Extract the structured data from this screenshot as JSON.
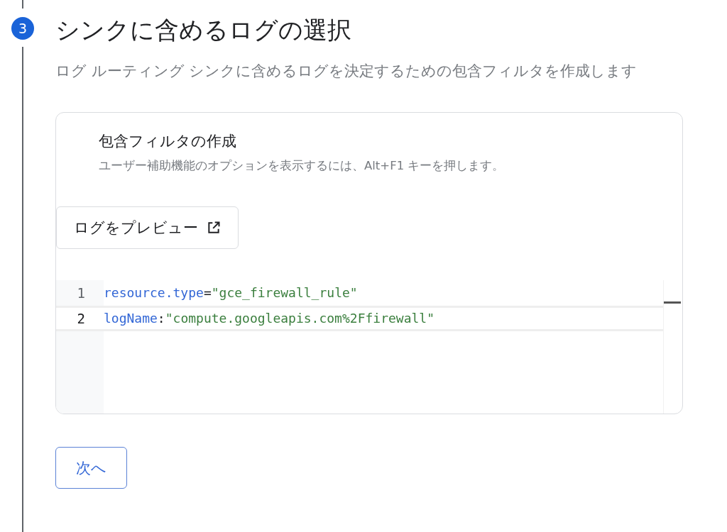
{
  "step": {
    "number": "3",
    "title": "シンクに含めるログの選択",
    "description": "ログ ルーティング シンクに含めるログを決定するための包含フィルタを作成します"
  },
  "filter_card": {
    "title": "包含フィルタの作成",
    "hint": "ユーザー補助機能のオプションを表示するには、Alt+F1 キーを押します。",
    "preview_button": "ログをプレビュー"
  },
  "editor": {
    "lines": [
      {
        "number": "1",
        "selected": false,
        "tokens": [
          {
            "kind": "key",
            "text": "resource.type"
          },
          {
            "kind": "op",
            "text": "="
          },
          {
            "kind": "string",
            "text": "\"gce_firewall_rule\""
          }
        ]
      },
      {
        "number": "2",
        "selected": true,
        "tokens": [
          {
            "kind": "key",
            "text": "logName"
          },
          {
            "kind": "op",
            "text": ":"
          },
          {
            "kind": "string",
            "text": "\"compute.googleapis.com%2Ffirewall\""
          }
        ]
      }
    ]
  },
  "next_button": "次へ"
}
